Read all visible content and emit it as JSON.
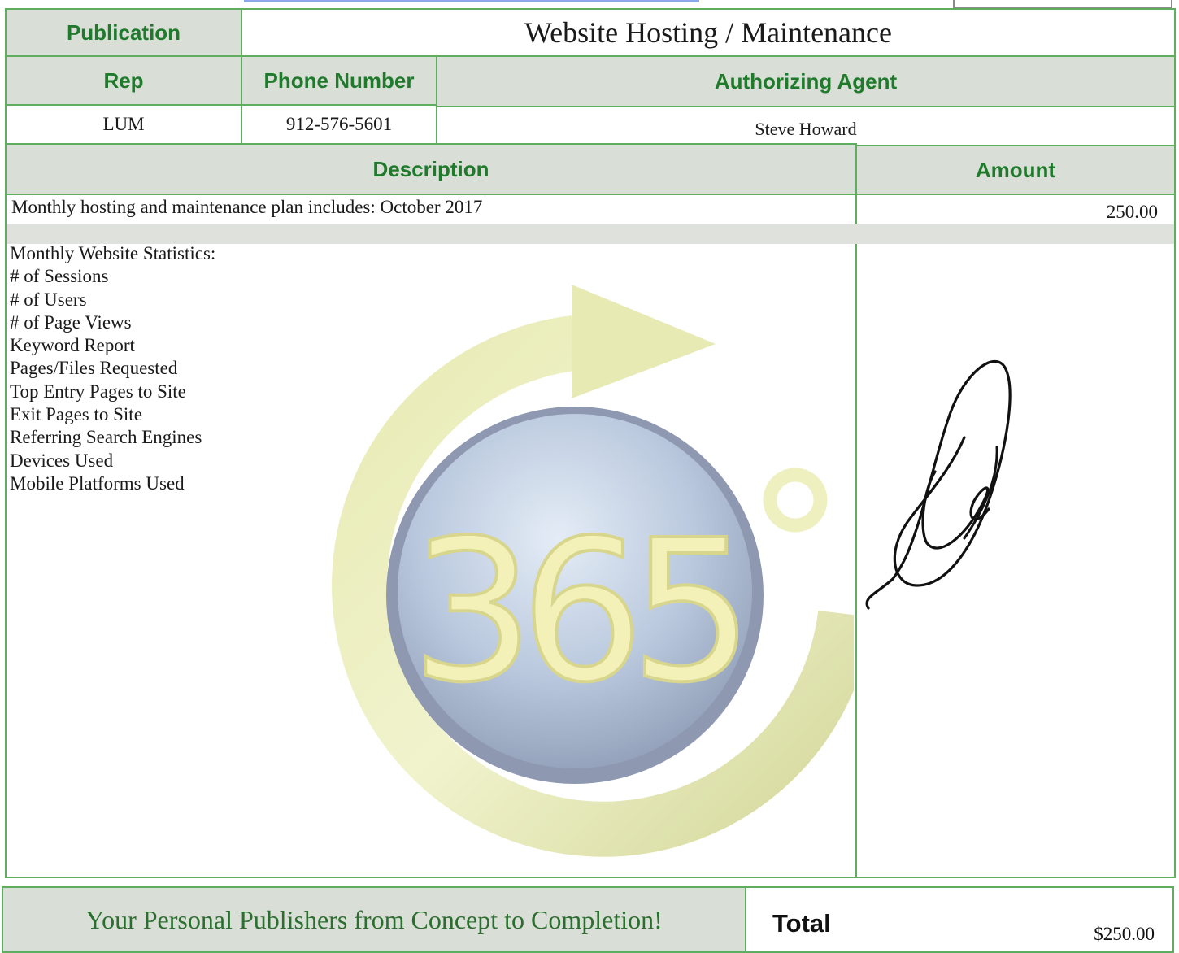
{
  "header": {
    "publication_label": "Publication",
    "publication_value": "Website Hosting / Maintenance",
    "rep_label": "Rep",
    "phone_label": "Phone Number",
    "agent_label": "Authorizing Agent",
    "rep_value": "LUM",
    "phone_value": "912-576-5601",
    "agent_value": "Steve Howard"
  },
  "line_items": {
    "description_label": "Description",
    "amount_label": "Amount",
    "plan_text": "Monthly hosting and maintenance plan includes: October 2017",
    "plan_amount": "250.00",
    "stats_heading": "Monthly Website Statistics:",
    "stats": [
      "# of Sessions",
      "# of Users",
      "# of Page Views",
      "Keyword Report",
      "Pages/Files Requested",
      "Top Entry Pages to Site",
      "Exit Pages to Site",
      "Referring Search Engines",
      "Devices Used",
      "Mobile Platforms Used"
    ]
  },
  "logo": {
    "number": "365",
    "degree_symbol": "°"
  },
  "footer": {
    "slogan": "Your Personal Publishers from Concept to Completion!",
    "total_label": "Total",
    "total_value": "$250.00"
  },
  "colors": {
    "header_green": "#1f7a2c",
    "border_green": "#5fae5f",
    "header_bg": "#d9dfd6",
    "logo_yellow": "#eef0b8",
    "logo_ring": "#dfe3a6",
    "logo_sphere": "#b8c6dc"
  }
}
